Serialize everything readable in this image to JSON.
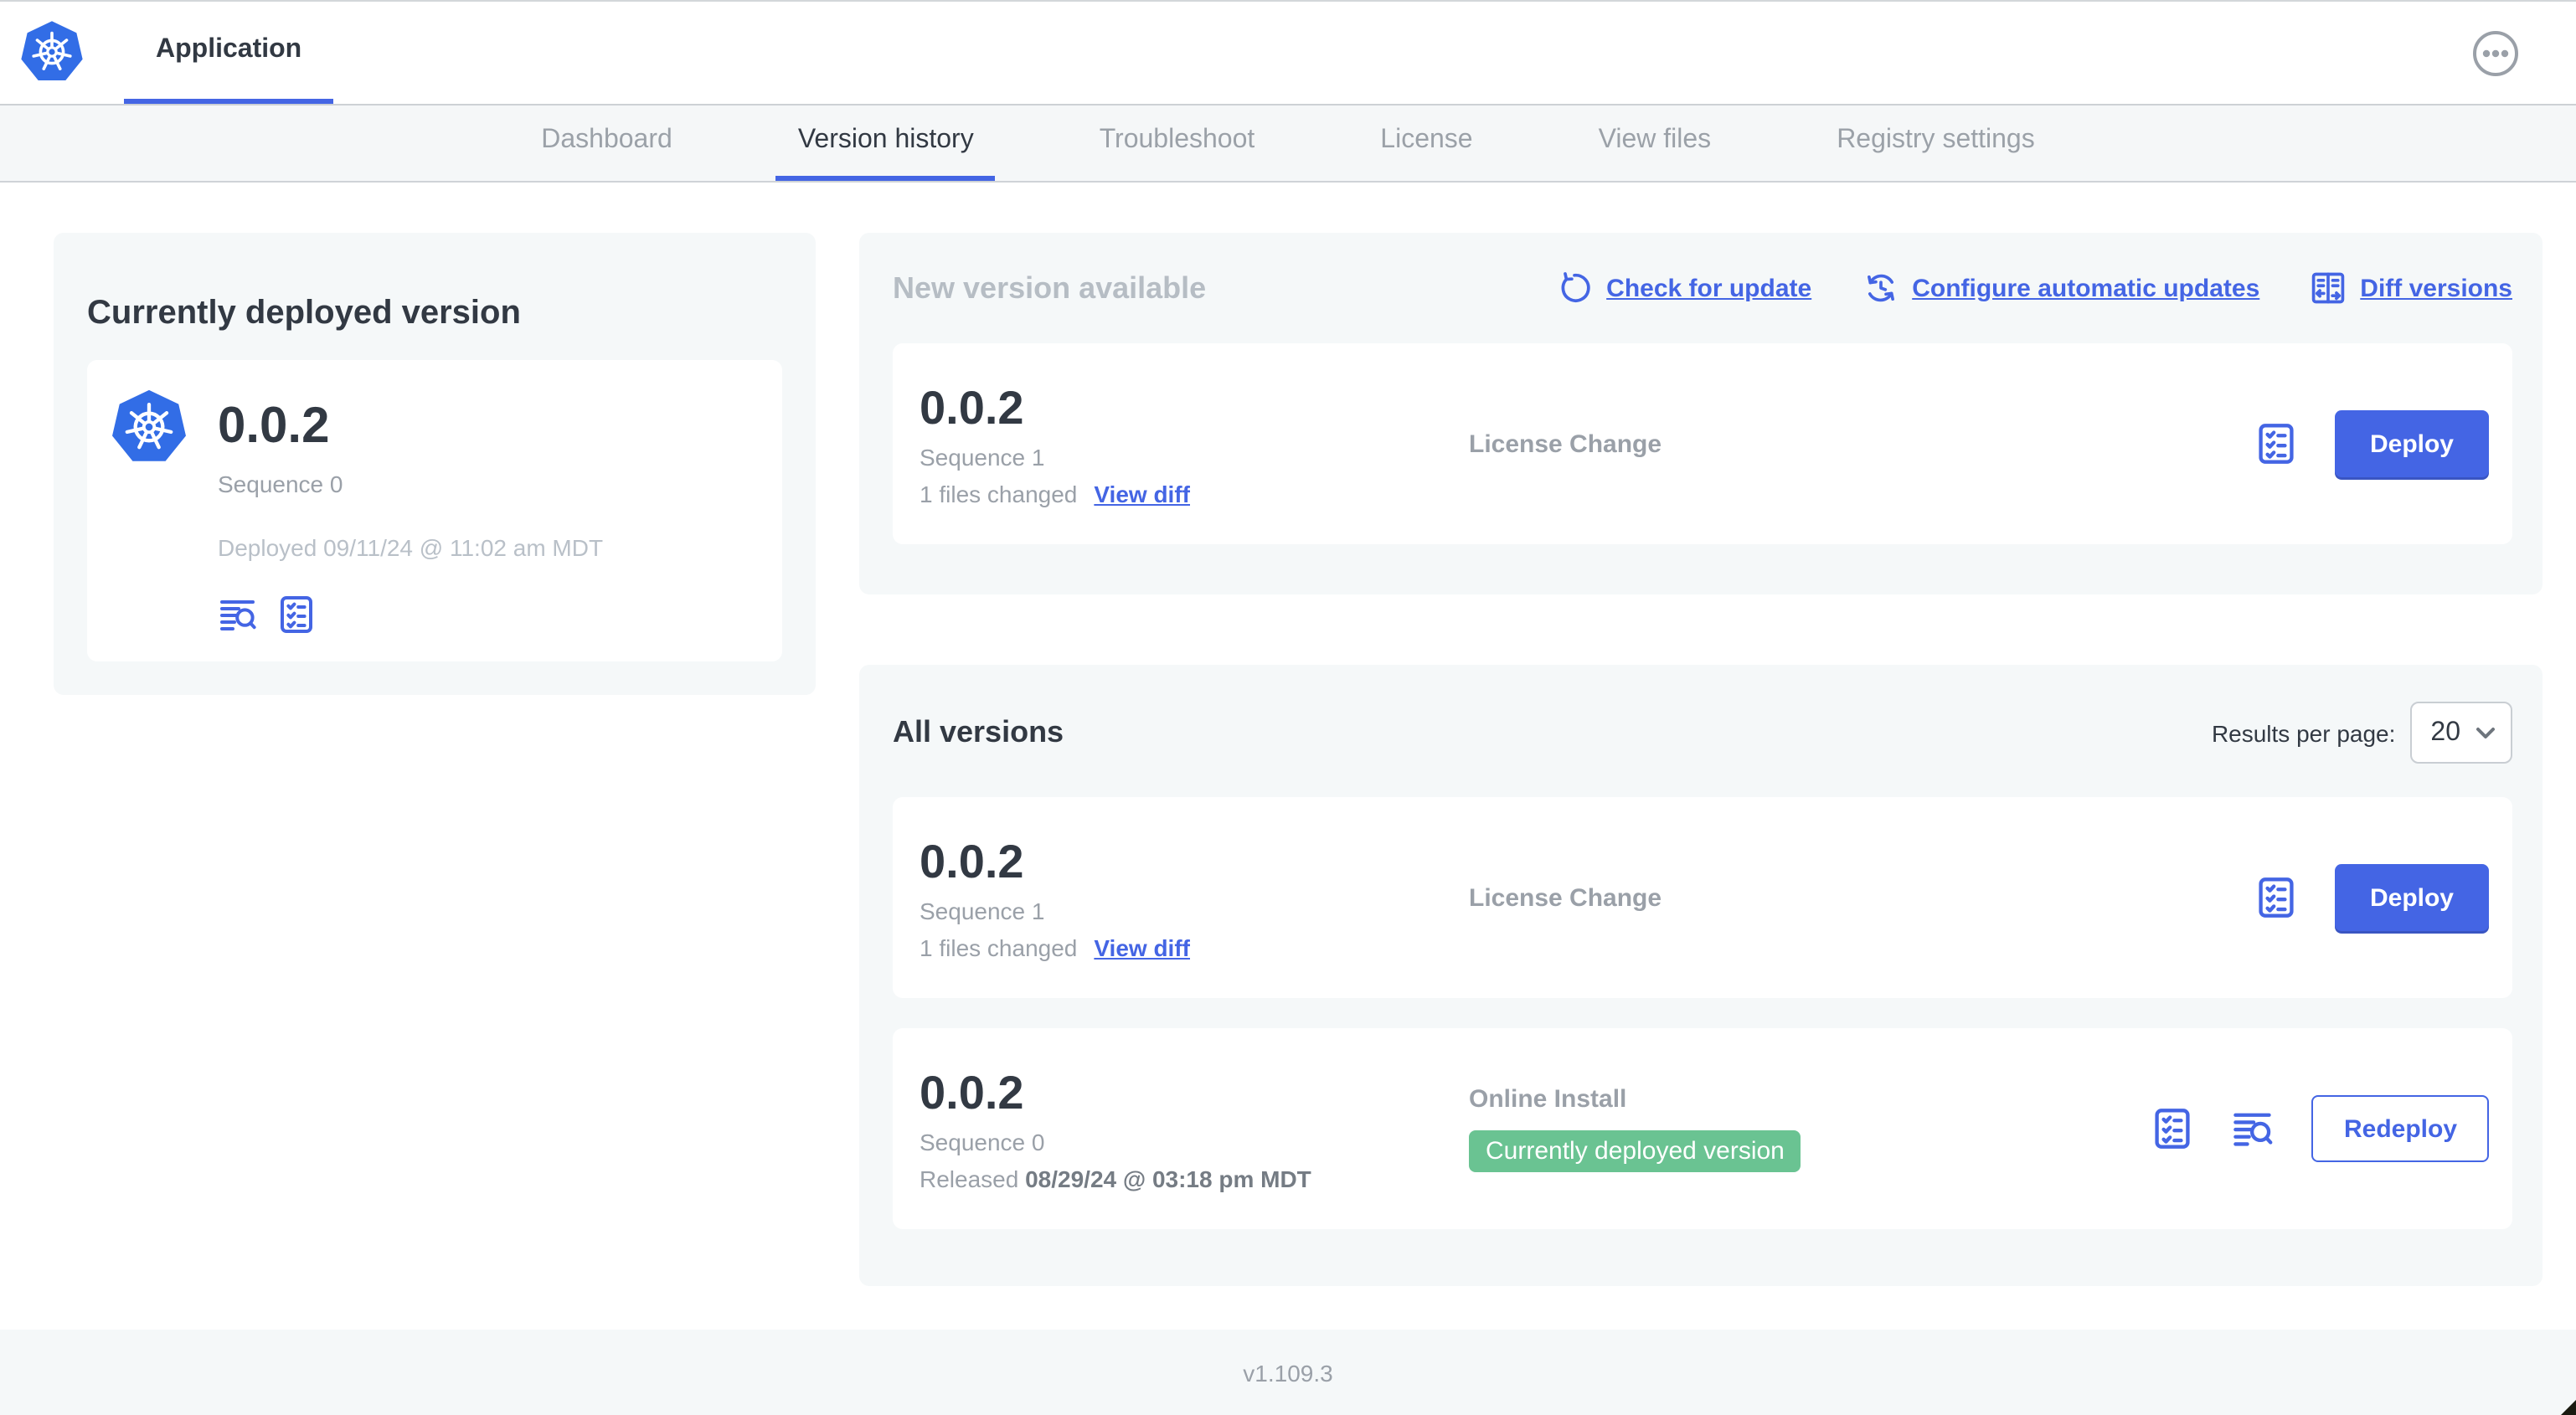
{
  "header": {
    "app_name": "Application"
  },
  "nav": {
    "tabs": [
      {
        "label": "Dashboard"
      },
      {
        "label": "Version history"
      },
      {
        "label": "Troubleshoot"
      },
      {
        "label": "License"
      },
      {
        "label": "View files"
      },
      {
        "label": "Registry settings"
      }
    ]
  },
  "current_version": {
    "title": "Currently deployed version",
    "version": "0.0.2",
    "sequence": "Sequence 0",
    "deployed": "Deployed 09/11/24 @ 11:02 am MDT"
  },
  "new_version": {
    "title": "New version available",
    "check_for_update": "Check for update",
    "configure_updates": "Configure automatic updates",
    "diff_versions": "Diff versions",
    "card": {
      "version": "0.0.2",
      "sequence": "Sequence 1",
      "files_changed": "1 files changed",
      "view_diff": "View diff",
      "source": "License Change",
      "action": "Deploy"
    }
  },
  "all_versions": {
    "title": "All versions",
    "results_label": "Results per page:",
    "results_value": "20",
    "rows": [
      {
        "version": "0.0.2",
        "sequence": "Sequence 1",
        "files_changed": "1 files changed",
        "view_diff": "View diff",
        "source": "License Change",
        "action": "Deploy"
      },
      {
        "version": "0.0.2",
        "sequence": "Sequence 0",
        "released_label": "Released",
        "released_date": "08/29/24 @ 03:18 pm MDT",
        "source": "Online Install",
        "badge": "Currently deployed version",
        "action": "Redeploy"
      }
    ]
  },
  "footer": {
    "app_version": "v1.109.3"
  },
  "icons": {
    "logo": "kubernetes-logo",
    "menu": "ellipsis-menu-icon",
    "check_update": "refresh-icon",
    "auto_updates": "clock-refresh-icon",
    "diff": "diff-columns-icon",
    "preflight": "checklist-icon",
    "logs": "view-logs-icon",
    "select": "chevron-down-icon"
  },
  "colors": {
    "accent_blue": "#4465e4",
    "kubernetes_blue": "#326de6",
    "badge_green": "#6ac392",
    "dark_text": "#323943",
    "muted_text": "#9aa0a8",
    "light_text": "#b9c0c8",
    "panel_bg": "#f5f8f9"
  }
}
